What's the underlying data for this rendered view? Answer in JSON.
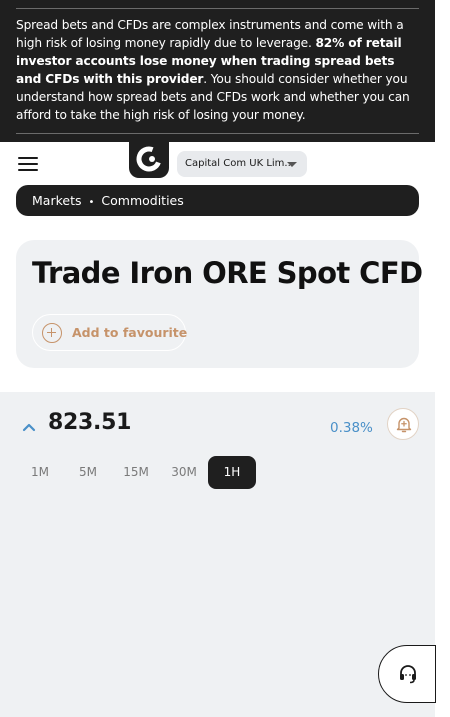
{
  "risk_warning": {
    "part1": "Spread bets and CFDs are complex instruments and come with a high risk of losing money rapidly due to leverage. ",
    "bold": "82% of retail investor accounts lose money when trading spread bets and CFDs with this provider",
    "part2": ". You should consider whether you understand how spread bets and CFDs work and whether you can afford to take the high risk of losing your money."
  },
  "header": {
    "menu_icon": "hamburger-icon",
    "logo_icon": "capital-com-logo",
    "entity_select": "Capital Com UK Lim..."
  },
  "breadcrumb": {
    "items": [
      "Markets",
      "Commodities"
    ],
    "separator": "•"
  },
  "instrument": {
    "title": "Trade Iron ORE Spot CFD",
    "favourite_label": "Add to favourite"
  },
  "quote": {
    "direction_icon": "chevron-up-icon",
    "price": "823.51",
    "change": "0.38%",
    "alert_icon": "bell-plus-icon"
  },
  "timeframes": {
    "options": [
      "1M",
      "5M",
      "15M",
      "30M",
      "1H"
    ],
    "selected": "1H"
  },
  "support": {
    "icon": "headset-icon"
  },
  "colors": {
    "banner_bg": "#1f1f1f",
    "accent": "#c6936a",
    "change_blue": "#4a90c8",
    "panel_bg": "#eff1f3"
  }
}
